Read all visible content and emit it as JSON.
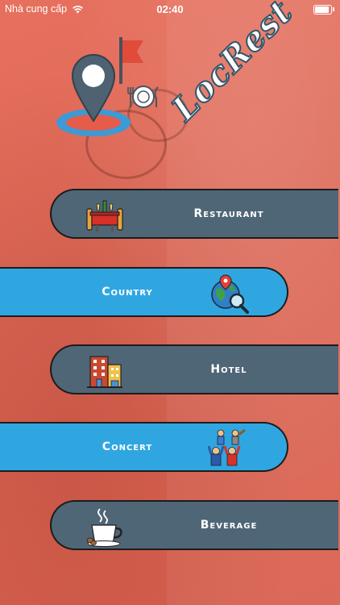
{
  "status_bar": {
    "carrier": "Nhà cung cấp",
    "time": "02:40"
  },
  "app": {
    "brand": "LocRest"
  },
  "menu": [
    {
      "label": "Restaurant",
      "icon": "restaurant-table-icon",
      "style": "dark"
    },
    {
      "label": "Country",
      "icon": "globe-search-icon",
      "style": "light"
    },
    {
      "label": "Hotel",
      "icon": "hotel-building-icon",
      "style": "dark"
    },
    {
      "label": "Concert",
      "icon": "concert-crowd-icon",
      "style": "light"
    },
    {
      "label": "Beverage",
      "icon": "coffee-cup-icon",
      "style": "dark"
    }
  ],
  "colors": {
    "background": "#e06a58",
    "dark_pill": "#4f6677",
    "light_pill": "#30a6e1",
    "brand_outline": "#33556a"
  }
}
